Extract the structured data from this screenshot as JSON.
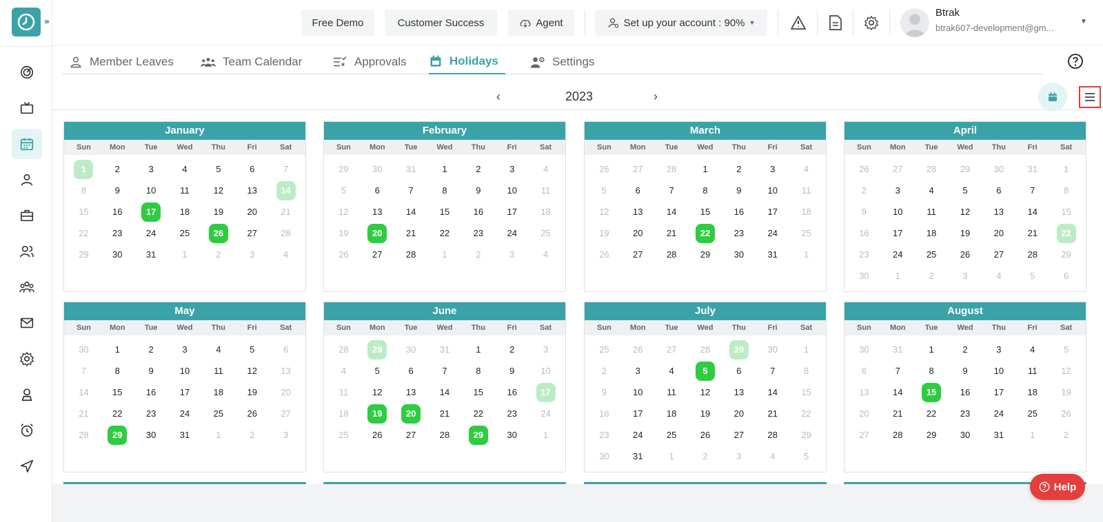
{
  "header": {
    "free_demo": "Free Demo",
    "customer_success": "Customer Success",
    "agent": "Agent",
    "setup": "Set up your account : 90%",
    "user_name": "Btrak",
    "user_email": "btrak607-development@gm..."
  },
  "tabs": [
    {
      "label": "Member Leaves",
      "icon": "person-icon"
    },
    {
      "label": "Team Calendar",
      "icon": "team-icon"
    },
    {
      "label": "Approvals",
      "icon": "approvals-icon"
    },
    {
      "label": "Holidays",
      "icon": "calendar-icon"
    },
    {
      "label": "Settings",
      "icon": "user-settings-icon"
    }
  ],
  "active_tab": "Holidays",
  "year": "2023",
  "weekdays": [
    "Sun",
    "Mon",
    "Tue",
    "Wed",
    "Thu",
    "Fri",
    "Sat"
  ],
  "help_label": "Help",
  "colors": {
    "accent": "#3aa3a8",
    "holiday": "#2ecc40",
    "holiday_faded": "#bdebc5",
    "help": "#e53e3e",
    "highlight": "#e53935"
  },
  "months": [
    {
      "name": "January",
      "days": [
        "1",
        "2",
        "3",
        "4",
        "5",
        "6",
        "7",
        "8",
        "9",
        "10",
        "11",
        "12",
        "13",
        "14",
        "15",
        "16",
        "17",
        "18",
        "19",
        "20",
        "21",
        "22",
        "23",
        "24",
        "25",
        "26",
        "27",
        "28",
        "29",
        "30",
        "31",
        "1",
        "2",
        "3",
        "4"
      ],
      "muted": [
        0,
        6,
        7,
        13,
        14,
        20,
        21,
        27,
        28,
        31,
        32,
        33,
        34
      ],
      "holidays": [
        0,
        13,
        16,
        25
      ]
    },
    {
      "name": "February",
      "days": [
        "29",
        "30",
        "31",
        "1",
        "2",
        "3",
        "4",
        "5",
        "6",
        "7",
        "8",
        "9",
        "10",
        "11",
        "12",
        "13",
        "14",
        "15",
        "16",
        "17",
        "18",
        "19",
        "20",
        "21",
        "22",
        "23",
        "24",
        "25",
        "26",
        "27",
        "28",
        "1",
        "2",
        "3",
        "4"
      ],
      "muted": [
        0,
        1,
        2,
        6,
        7,
        13,
        14,
        20,
        21,
        27,
        28,
        31,
        32,
        33,
        34
      ],
      "holidays": [
        22
      ]
    },
    {
      "name": "March",
      "days": [
        "26",
        "27",
        "28",
        "1",
        "2",
        "3",
        "4",
        "5",
        "6",
        "7",
        "8",
        "9",
        "10",
        "11",
        "12",
        "13",
        "14",
        "15",
        "16",
        "17",
        "18",
        "19",
        "20",
        "21",
        "22",
        "23",
        "24",
        "25",
        "26",
        "27",
        "28",
        "29",
        "30",
        "31",
        "1"
      ],
      "muted": [
        0,
        1,
        2,
        6,
        7,
        13,
        14,
        20,
        21,
        27,
        28,
        34
      ],
      "holidays": [
        24
      ]
    },
    {
      "name": "April",
      "days": [
        "26",
        "27",
        "28",
        "29",
        "30",
        "31",
        "1",
        "2",
        "3",
        "4",
        "5",
        "6",
        "7",
        "8",
        "9",
        "10",
        "11",
        "12",
        "13",
        "14",
        "15",
        "16",
        "17",
        "18",
        "19",
        "20",
        "21",
        "22",
        "23",
        "24",
        "25",
        "26",
        "27",
        "28",
        "29",
        "30",
        "1",
        "2",
        "3",
        "4",
        "5",
        "6"
      ],
      "muted": [
        0,
        1,
        2,
        3,
        4,
        5,
        6,
        7,
        13,
        14,
        20,
        21,
        27,
        28,
        34,
        35,
        36,
        37,
        38,
        39,
        40,
        41
      ],
      "holidays": [
        27
      ]
    },
    {
      "name": "May",
      "days": [
        "30",
        "1",
        "2",
        "3",
        "4",
        "5",
        "6",
        "7",
        "8",
        "9",
        "10",
        "11",
        "12",
        "13",
        "14",
        "15",
        "16",
        "17",
        "18",
        "19",
        "20",
        "21",
        "22",
        "23",
        "24",
        "25",
        "26",
        "27",
        "28",
        "29",
        "30",
        "31",
        "1",
        "2",
        "3"
      ],
      "muted": [
        0,
        6,
        7,
        13,
        14,
        20,
        21,
        27,
        28,
        32,
        33,
        34
      ],
      "holidays": [
        29
      ]
    },
    {
      "name": "June",
      "days": [
        "28",
        "29",
        "30",
        "31",
        "1",
        "2",
        "3",
        "4",
        "5",
        "6",
        "7",
        "8",
        "9",
        "10",
        "11",
        "12",
        "13",
        "14",
        "15",
        "16",
        "17",
        "18",
        "19",
        "20",
        "21",
        "22",
        "23",
        "24",
        "25",
        "26",
        "27",
        "28",
        "29",
        "30",
        "1"
      ],
      "muted": [
        0,
        1,
        2,
        3,
        6,
        7,
        13,
        14,
        20,
        21,
        27,
        28,
        34
      ],
      "holidays": [
        1,
        20,
        22,
        23,
        32
      ]
    },
    {
      "name": "July",
      "days": [
        "25",
        "26",
        "27",
        "28",
        "29",
        "30",
        "1",
        "2",
        "3",
        "4",
        "5",
        "6",
        "7",
        "8",
        "9",
        "10",
        "11",
        "12",
        "13",
        "14",
        "15",
        "16",
        "17",
        "18",
        "19",
        "20",
        "21",
        "22",
        "23",
        "24",
        "25",
        "26",
        "27",
        "28",
        "29",
        "30",
        "31",
        "1",
        "2",
        "3",
        "4",
        "5"
      ],
      "muted": [
        0,
        1,
        2,
        3,
        4,
        5,
        6,
        7,
        13,
        14,
        20,
        21,
        27,
        28,
        34,
        35,
        37,
        38,
        39,
        40,
        41
      ],
      "holidays": [
        4,
        10
      ]
    },
    {
      "name": "August",
      "days": [
        "30",
        "31",
        "1",
        "2",
        "3",
        "4",
        "5",
        "6",
        "7",
        "8",
        "9",
        "10",
        "11",
        "12",
        "13",
        "14",
        "15",
        "16",
        "17",
        "18",
        "19",
        "20",
        "21",
        "22",
        "23",
        "24",
        "25",
        "26",
        "27",
        "28",
        "29",
        "30",
        "31",
        "1",
        "2"
      ],
      "muted": [
        0,
        1,
        6,
        7,
        13,
        14,
        20,
        21,
        27,
        28,
        33,
        34
      ],
      "holidays": [
        16
      ]
    }
  ]
}
